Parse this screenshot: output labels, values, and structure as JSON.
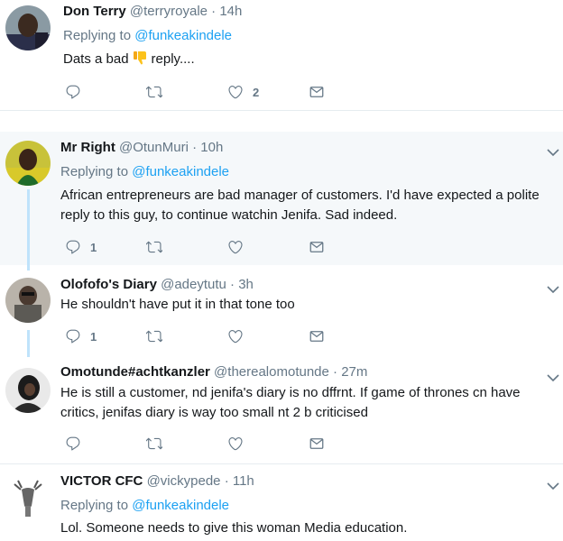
{
  "tweets": [
    {
      "name": "Don Terry",
      "handle": "@terryroyale",
      "time": "14h",
      "replying_prefix": "Replying to",
      "replying_to": "@funkeakindele",
      "text_before": "Dats a bad",
      "text_emoji": "thumbs-down-emoji",
      "text_after": "reply....",
      "reply_count": "",
      "like_count": "2"
    },
    {
      "name": "Mr Right",
      "handle": "@OtunMuri",
      "time": "10h",
      "replying_prefix": "Replying to",
      "replying_to": "@funkeakindele",
      "text": "African entrepreneurs are bad manager of customers. I'd have expected a polite reply to this guy, to continue watchin Jenifa. Sad indeed.",
      "reply_count": "1",
      "like_count": ""
    },
    {
      "name": "Olofofo's Diary",
      "handle": "@adeytutu",
      "time": "3h",
      "text": "He shouldn't have put it in that tone too",
      "reply_count": "1",
      "like_count": ""
    },
    {
      "name": "Omotunde#achtkanzler",
      "handle": "@therealomotunde",
      "time": "27m",
      "text": "He is still a customer, nd jenifa's diary is no dffrnt. If game of thrones cn have critics, jenifas diary is way too small nt 2 b criticised",
      "reply_count": "",
      "like_count": ""
    },
    {
      "name": "VICTOR CFC",
      "handle": "@vickypede",
      "time": "11h",
      "replying_prefix": "Replying to",
      "replying_to": "@funkeakindele",
      "text": "Lol. Someone needs to give this woman Media education."
    }
  ],
  "separator": "·",
  "icons": {
    "reply": "reply-icon",
    "retweet": "retweet-icon",
    "like": "heart-icon",
    "dm": "envelope-icon",
    "more": "chevron-down-icon"
  },
  "colors": {
    "link": "#1da1f2",
    "muted": "#657786",
    "highlight_bg": "#f5f8fa",
    "thread_line": "#bfe3fb"
  }
}
